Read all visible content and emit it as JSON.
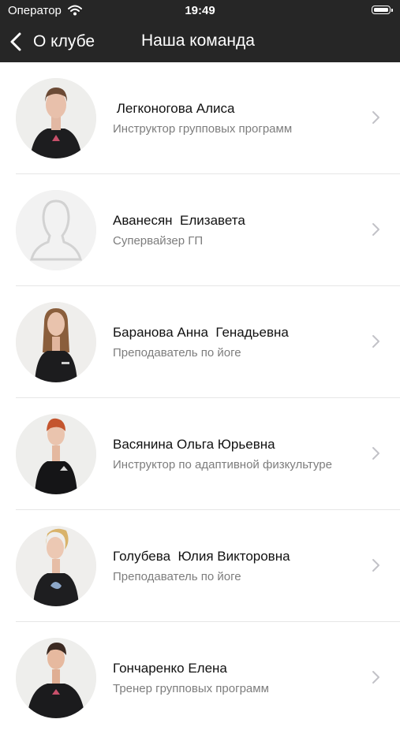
{
  "status_bar": {
    "carrier": "Оператор",
    "time": "19:49"
  },
  "nav": {
    "back_label": "О клубе",
    "title": "Наша команда"
  },
  "colors": {
    "header_bg": "#262626",
    "text_primary": "#111111",
    "text_secondary": "#7d7d7d",
    "divider": "#e6e6e6"
  },
  "team": [
    {
      "name": " Легконогова Алиса",
      "role": "Инструктор групповых программ",
      "avatar": "photo"
    },
    {
      "name": "Аванесян  Елизавета",
      "role": "Супервайзер ГП",
      "avatar": "placeholder"
    },
    {
      "name": "Баранова Анна  Генадьевна",
      "role": "Преподаватель по йоге",
      "avatar": "photo"
    },
    {
      "name": "Васянина Ольга Юрьевна",
      "role": "Инструктор по адаптивной физкультуре",
      "avatar": "photo"
    },
    {
      "name": "Голубева  Юлия Викторовна",
      "role": "Преподаватель по йоге",
      "avatar": "photo"
    },
    {
      "name": "Гончаренко Елена",
      "role": "Тренер групповых программ",
      "avatar": "photo"
    }
  ]
}
